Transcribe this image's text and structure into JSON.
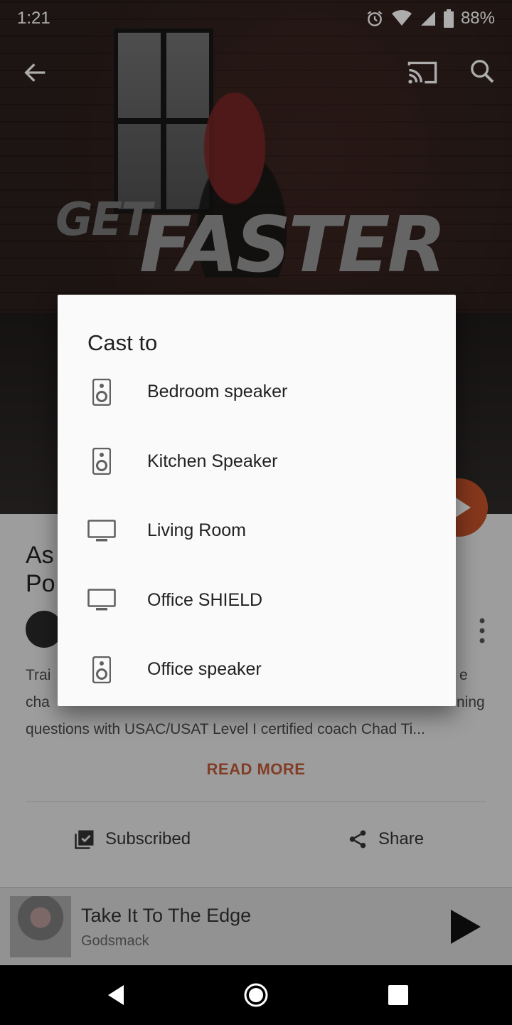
{
  "status_bar": {
    "time": "1:21",
    "battery": "88%"
  },
  "hero": {
    "title_small": "GET",
    "title_big": "FASTER"
  },
  "podcast": {
    "title_visible_line1": "As",
    "title_visible_line2": "Po",
    "description_lines": [
      "Trai",
      "cha",
      "questions with USAC/USAT Level I certified coach Chad Ti..."
    ],
    "description_right_fragments": [
      "e",
      "ning"
    ],
    "read_more_label": "READ MORE",
    "subscribed_label": "Subscribed",
    "share_label": "Share"
  },
  "mini_player": {
    "track_title": "Take It To The Edge",
    "artist": "Godsmack"
  },
  "cast_dialog": {
    "title": "Cast to",
    "devices": [
      {
        "label": "Bedroom speaker",
        "icon": "speaker-icon"
      },
      {
        "label": "Kitchen Speaker",
        "icon": "speaker-icon"
      },
      {
        "label": "Living Room",
        "icon": "tv-icon"
      },
      {
        "label": "Office SHIELD",
        "icon": "tv-icon"
      },
      {
        "label": "Office speaker",
        "icon": "speaker-icon"
      }
    ]
  },
  "colors": {
    "accent": "#c4522a",
    "read_more": "#c05a3a",
    "dialog_bg": "#fafafa"
  }
}
